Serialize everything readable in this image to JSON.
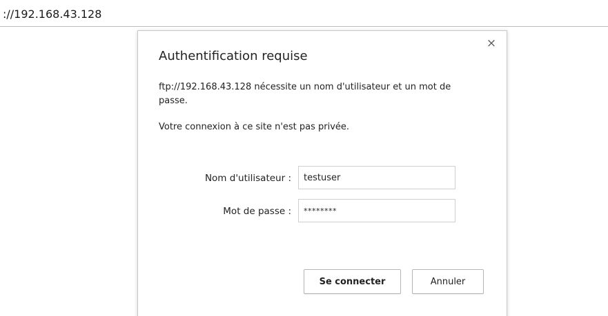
{
  "browser": {
    "address_text": "://192.168.43.128"
  },
  "dialog": {
    "title": "Authentification requise",
    "message": "ftp://192.168.43.128 nécessite un nom d'utilisateur et un mot de passe.",
    "warning": "Votre connexion à ce site n'est pas privée.",
    "close_icon": "×",
    "username_label": "Nom d'utilisateur :",
    "username_value": "testuser",
    "password_label": "Mot de passe :",
    "password_value": "********",
    "login_button": "Se connecter",
    "cancel_button": "Annuler"
  }
}
